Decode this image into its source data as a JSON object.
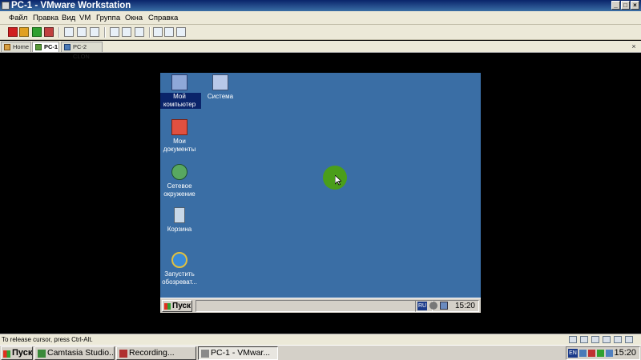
{
  "window": {
    "title": "PC-1 - VMware Workstation"
  },
  "menu": [
    "Файл",
    "Правка",
    "Вид",
    "VM",
    "Группа",
    "Окна",
    "Справка"
  ],
  "tabs": [
    {
      "label": "Home"
    },
    {
      "label": "PC-1"
    },
    {
      "label": "PC-2 CLON"
    }
  ],
  "guest": {
    "desktop_icons": [
      {
        "label": "Мой компьютер",
        "icon": "my-computer-icon"
      },
      {
        "label": "Система",
        "icon": "system-icon"
      },
      {
        "label": "Мои документы",
        "icon": "my-documents-icon"
      },
      {
        "label": "Сетевое окружение",
        "icon": "network-icon"
      },
      {
        "label": "Корзина",
        "icon": "recycle-bin-icon"
      },
      {
        "label": "Запустить обозреват...",
        "icon": "internet-explorer-icon"
      }
    ],
    "taskbar": {
      "start_label": "Пуск",
      "lang": "RU",
      "clock": "15:20"
    },
    "desktop_color": "#3a6ea5"
  },
  "status": {
    "message": "To release cursor, press Ctrl-Alt."
  },
  "host_taskbar": {
    "start_label": "Пуск",
    "tasks": [
      {
        "label": "Camtasia Studio..."
      },
      {
        "label": "Recording..."
      },
      {
        "label": "PC-1 - VMwar..."
      }
    ],
    "lang": "EN",
    "clock": "15:20"
  },
  "colors": {
    "titlebar": "#0a246a",
    "cursor_highlight": "#4a9e1a"
  }
}
